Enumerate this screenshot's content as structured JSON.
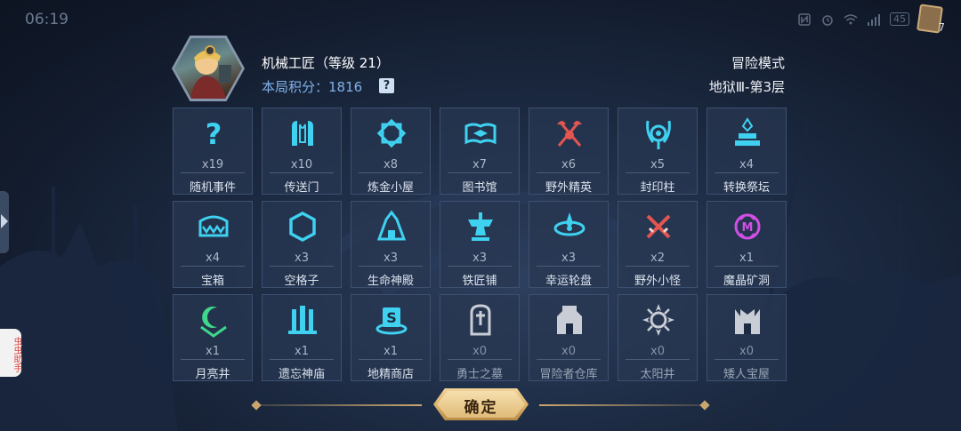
{
  "status_bar": {
    "time": "06:19",
    "battery": "45",
    "card_count": "7"
  },
  "side_helper": {
    "label": "虫虫助手"
  },
  "header": {
    "hero_name": "机械工匠（等级 21）",
    "score_label": "本局积分：",
    "score_value": "1816",
    "help_label": "?",
    "mode": "冒险模式",
    "floor": "地狱Ⅲ-第3层"
  },
  "colors": {
    "cyan_icon": "#3fd1f0",
    "red_icon": "#e4554f",
    "purple_icon": "#d04fe6",
    "green_icon": "#3fd88a",
    "grey_icon": "#c9ced6",
    "gold_button": "#e0bb78"
  },
  "grid": [
    {
      "icon": "question-icon",
      "count": "x19",
      "label": "随机事件",
      "color": "#3fd1f0",
      "dim": false
    },
    {
      "icon": "portal-icon",
      "count": "x10",
      "label": "传送门",
      "color": "#3fd1f0",
      "dim": false
    },
    {
      "icon": "alchemy-hut-icon",
      "count": "x8",
      "label": "炼金小屋",
      "color": "#3fd1f0",
      "dim": false
    },
    {
      "icon": "library-book-icon",
      "count": "x7",
      "label": "图书馆",
      "color": "#3fd1f0",
      "dim": false
    },
    {
      "icon": "crossed-axes-icon",
      "count": "x6",
      "label": "野外精英",
      "color": "#e4554f",
      "dim": false
    },
    {
      "icon": "seal-pillar-icon",
      "count": "x5",
      "label": "封印柱",
      "color": "#3fd1f0",
      "dim": false
    },
    {
      "icon": "altar-icon",
      "count": "x4",
      "label": "转换祭坛",
      "color": "#3fd1f0",
      "dim": false
    },
    {
      "icon": "treasure-chest-icon",
      "count": "x4",
      "label": "宝箱",
      "color": "#3fd1f0",
      "dim": false
    },
    {
      "icon": "hexagon-icon",
      "count": "x3",
      "label": "空格子",
      "color": "#3fd1f0",
      "dim": false
    },
    {
      "icon": "life-temple-icon",
      "count": "x3",
      "label": "生命神殿",
      "color": "#3fd1f0",
      "dim": false
    },
    {
      "icon": "anvil-icon",
      "count": "x3",
      "label": "铁匠铺",
      "color": "#3fd1f0",
      "dim": false
    },
    {
      "icon": "lucky-wheel-icon",
      "count": "x3",
      "label": "幸运轮盘",
      "color": "#3fd1f0",
      "dim": false
    },
    {
      "icon": "crossed-swords-icon",
      "count": "x2",
      "label": "野外小怪",
      "color": "#e4554f",
      "dim": false
    },
    {
      "icon": "magic-crystal-icon",
      "count": "x1",
      "label": "魔晶矿洞",
      "color": "#d04fe6",
      "dim": false
    },
    {
      "icon": "moon-well-icon",
      "count": "x1",
      "label": "月亮井",
      "color": "#3fd88a",
      "dim": false
    },
    {
      "icon": "forgotten-temple-icon",
      "count": "x1",
      "label": "遗忘神庙",
      "color": "#3fd1f0",
      "dim": false
    },
    {
      "icon": "goblin-shop-icon",
      "count": "x1",
      "label": "地精商店",
      "color": "#3fd1f0",
      "dim": false
    },
    {
      "icon": "warrior-tomb-icon",
      "count": "x0",
      "label": "勇士之墓",
      "color": "#c9ced6",
      "dim": true
    },
    {
      "icon": "adventurer-warehouse-icon",
      "count": "x0",
      "label": "冒险者仓库",
      "color": "#c9ced6",
      "dim": true
    },
    {
      "icon": "sun-well-icon",
      "count": "x0",
      "label": "太阳井",
      "color": "#c9ced6",
      "dim": true
    },
    {
      "icon": "dwarf-treasure-icon",
      "count": "x0",
      "label": "矮人宝屋",
      "color": "#c9ced6",
      "dim": true
    }
  ],
  "confirm": {
    "label": "确定"
  }
}
